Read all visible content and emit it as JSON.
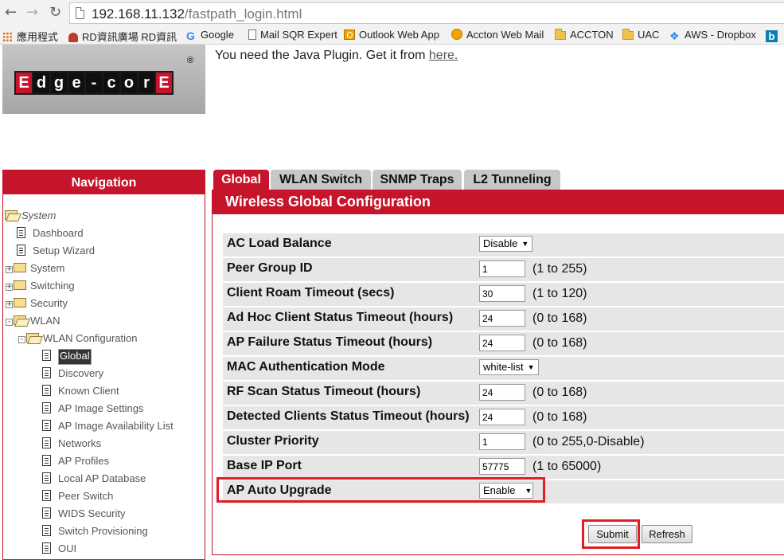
{
  "browser": {
    "url_host": "192.168.11.132",
    "url_path": "/fastpath_login.html",
    "bookmarks": [
      {
        "label": "應用程式",
        "icon": "apps-grid-icon"
      },
      {
        "label": "RD資訊廣場 RD資訊",
        "icon": "person-icon"
      },
      {
        "label": "Google",
        "icon": "google-icon"
      },
      {
        "label": "Mail SQR Expert",
        "icon": "page-icon"
      },
      {
        "label": "Outlook Web App",
        "icon": "outlook-icon"
      },
      {
        "label": "Accton Web Mail",
        "icon": "accton-icon"
      },
      {
        "label": "ACCTON",
        "icon": "folder-icon"
      },
      {
        "label": "UAC",
        "icon": "folder-icon"
      },
      {
        "label": "AWS - Dropbox",
        "icon": "dropbox-icon"
      },
      {
        "label": "b",
        "icon": "bing-icon"
      }
    ]
  },
  "header": {
    "logo_letters": [
      "E",
      "d",
      "g",
      "e",
      "-",
      "c",
      "o",
      "r",
      "E"
    ],
    "logo_reg": "®",
    "java_message": "You need the Java Plugin. Get it from ",
    "java_link": "here."
  },
  "navigation": {
    "title": "Navigation",
    "items": [
      {
        "label": "System",
        "icon": "folder-open-icon",
        "style": "italic"
      },
      {
        "label": "Dashboard",
        "icon": "page-icon"
      },
      {
        "label": "Setup Wizard",
        "icon": "page-icon"
      },
      {
        "label": "System",
        "icon": "folder-icon",
        "expander": "+"
      },
      {
        "label": "Switching",
        "icon": "folder-icon",
        "expander": "+"
      },
      {
        "label": "Security",
        "icon": "folder-icon",
        "expander": "+"
      },
      {
        "label": "WLAN",
        "icon": "folder-open-icon",
        "expander": "-"
      },
      {
        "label": "WLAN Configuration",
        "icon": "folder-open-icon",
        "expander": "-"
      },
      {
        "label": "Global",
        "icon": "page-icon",
        "selected": true
      },
      {
        "label": "Discovery",
        "icon": "page-icon"
      },
      {
        "label": "Known Client",
        "icon": "page-icon"
      },
      {
        "label": "AP Image Settings",
        "icon": "page-icon"
      },
      {
        "label": "AP Image Availability List",
        "icon": "page-icon"
      },
      {
        "label": "Networks",
        "icon": "page-icon"
      },
      {
        "label": "AP Profiles",
        "icon": "page-icon"
      },
      {
        "label": "Local AP Database",
        "icon": "page-icon"
      },
      {
        "label": "Peer Switch",
        "icon": "page-icon"
      },
      {
        "label": "WIDS Security",
        "icon": "page-icon"
      },
      {
        "label": "Switch Provisioning",
        "icon": "page-icon"
      },
      {
        "label": "OUI",
        "icon": "page-icon"
      }
    ]
  },
  "tabs": [
    {
      "label": "Global",
      "active": true
    },
    {
      "label": "WLAN Switch"
    },
    {
      "label": "SNMP Traps"
    },
    {
      "label": "L2 Tunneling"
    }
  ],
  "panel": {
    "title": "Wireless Global Configuration",
    "rows": [
      {
        "label": "AC Load Balance",
        "type": "select",
        "value": "Disable"
      },
      {
        "label": "Peer Group ID",
        "type": "text",
        "value": "1",
        "range": "(1 to 255)"
      },
      {
        "label": "Client Roam Timeout (secs)",
        "type": "text",
        "value": "30",
        "range": "(1 to 120)"
      },
      {
        "label": "Ad Hoc Client Status Timeout (hours)",
        "type": "text",
        "value": "24",
        "range": "(0 to 168)"
      },
      {
        "label": "AP Failure Status Timeout (hours)",
        "type": "text",
        "value": "24",
        "range": "(0 to 168)"
      },
      {
        "label": "MAC Authentication Mode",
        "type": "select",
        "value": "white-list"
      },
      {
        "label": "RF Scan Status Timeout (hours)",
        "type": "text",
        "value": "24",
        "range": "(0 to 168)"
      },
      {
        "label": "Detected Clients Status Timeout (hours)",
        "type": "text",
        "value": "24",
        "range": "(0 to 168)"
      },
      {
        "label": "Cluster Priority",
        "type": "text",
        "value": "1",
        "range": "(0 to 255,0-Disable)"
      },
      {
        "label": "Base IP Port",
        "type": "text",
        "value": "57775",
        "range": "(1 to 65000)"
      },
      {
        "label": "AP Auto Upgrade",
        "type": "select",
        "value": "Enable"
      }
    ],
    "submit_label": "Submit",
    "refresh_label": "Refresh"
  },
  "colors": {
    "brand_red": "#c6152a",
    "highlight_red": "#e21c24",
    "row_gray": "#e6e6e6"
  }
}
